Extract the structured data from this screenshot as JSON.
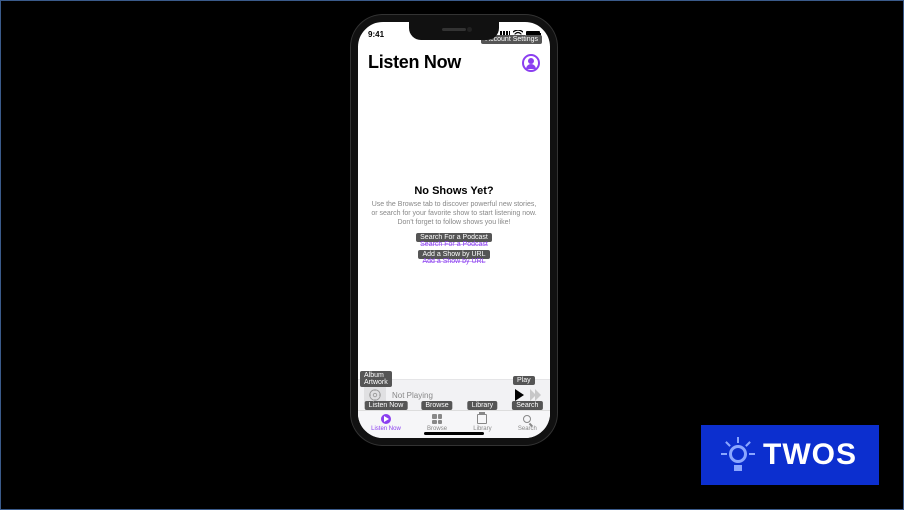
{
  "status": {
    "time": "9:41"
  },
  "header": {
    "title": "Listen Now",
    "account_tooltip": "Account Settings"
  },
  "empty_state": {
    "heading": "No Shows Yet?",
    "body": "Use the Browse tab to discover powerful new stories, or search for your favorite show to start listening now. Don't forget to follow shows you like!",
    "search_tooltip": "Search For a Podcast",
    "search_link": "Search For a Podcast",
    "url_tooltip": "Add a Show by URL",
    "url_link": "Add a Show by URL"
  },
  "player": {
    "artwork_tooltip": "Album Artwork",
    "status_text": "Not Playing",
    "play_tooltip": "Play"
  },
  "tabs": {
    "listen": {
      "label": "Listen Now",
      "tooltip": "Listen Now"
    },
    "browse": {
      "label": "Browse",
      "tooltip": "Browse"
    },
    "library": {
      "label": "Library",
      "tooltip": "Library"
    },
    "search": {
      "label": "Search",
      "tooltip": "Search"
    }
  },
  "badge": {
    "text": "TWOS"
  }
}
